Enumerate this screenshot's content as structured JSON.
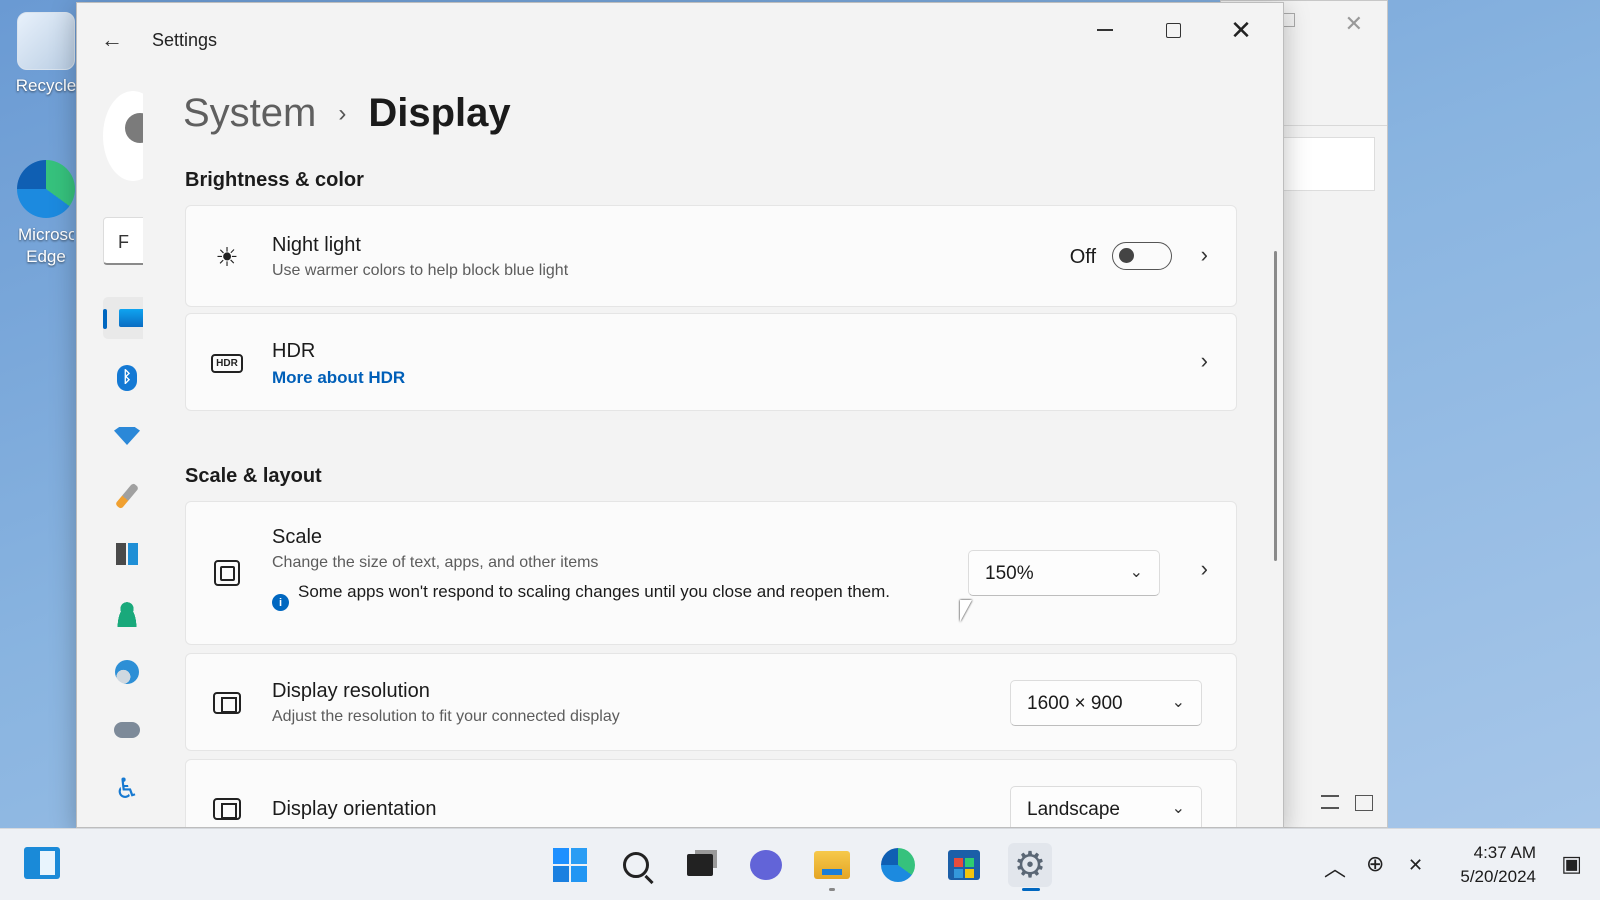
{
  "desktop": {
    "icons": [
      {
        "label": "Recycle"
      },
      {
        "label": "Microsoft Edge"
      }
    ]
  },
  "window": {
    "app_title": "Settings",
    "back_glyph": "←",
    "breadcrumb": {
      "parent": "System",
      "separator": "›",
      "current": "Display"
    },
    "search_value": "F"
  },
  "sections": {
    "brightness": "Brightness & color",
    "scale": "Scale & layout"
  },
  "night_light": {
    "title": "Night light",
    "subtitle": "Use warmer colors to help block blue light",
    "state_label": "Off",
    "enabled": false
  },
  "hdr": {
    "title": "HDR",
    "link": "More about HDR",
    "icon_text": "HDR"
  },
  "scale": {
    "title": "Scale",
    "subtitle": "Change the size of text, apps, and other items",
    "note": "Some apps won't respond to scaling changes until you close and reopen them.",
    "value": "150%"
  },
  "resolution": {
    "title": "Display resolution",
    "subtitle": "Adjust the resolution to fit your connected display",
    "value": "1600 × 900"
  },
  "orientation": {
    "title": "Display orientation",
    "value": "Landscape"
  },
  "glyphs": {
    "chevron_right": "›",
    "chevron_down": "⌄",
    "close": "✕",
    "sun": "☀",
    "accessibility": "♿",
    "gear": "⚙",
    "info": "i"
  },
  "taskbar": {
    "time": "4:37 AM",
    "date": "5/20/2024",
    "tray_up": "︿",
    "tray_net": "⊕",
    "tray_vol": "✕"
  },
  "colors": {
    "accent": "#0067c0",
    "link": "#005fb8",
    "desktop": "#89b4e0"
  }
}
